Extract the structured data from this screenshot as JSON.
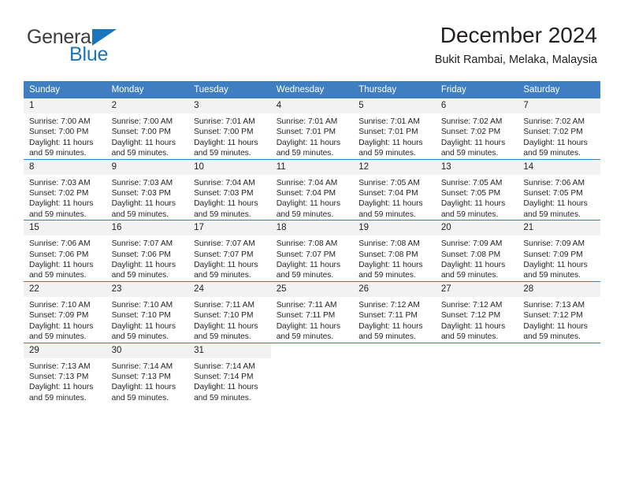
{
  "brand": {
    "name_part1": "General",
    "name_part2": "Blue",
    "logo_icon": "triangle-icon",
    "accent_color": "#1b75bb"
  },
  "header": {
    "title": "December 2024",
    "subtitle": "Bukit Rambai, Melaka, Malaysia"
  },
  "theme": {
    "header_blue": "#3f7fc1",
    "daynum_band": "#f2f2f2",
    "text": "#231f20"
  },
  "weekday_headers": [
    "Sunday",
    "Monday",
    "Tuesday",
    "Wednesday",
    "Thursday",
    "Friday",
    "Saturday"
  ],
  "weeks": [
    [
      {
        "day": "1",
        "sunrise": "Sunrise: 7:00 AM",
        "sunset": "Sunset: 7:00 PM",
        "daylight1": "Daylight: 11 hours",
        "daylight2": "and 59 minutes."
      },
      {
        "day": "2",
        "sunrise": "Sunrise: 7:00 AM",
        "sunset": "Sunset: 7:00 PM",
        "daylight1": "Daylight: 11 hours",
        "daylight2": "and 59 minutes."
      },
      {
        "day": "3",
        "sunrise": "Sunrise: 7:01 AM",
        "sunset": "Sunset: 7:00 PM",
        "daylight1": "Daylight: 11 hours",
        "daylight2": "and 59 minutes."
      },
      {
        "day": "4",
        "sunrise": "Sunrise: 7:01 AM",
        "sunset": "Sunset: 7:01 PM",
        "daylight1": "Daylight: 11 hours",
        "daylight2": "and 59 minutes."
      },
      {
        "day": "5",
        "sunrise": "Sunrise: 7:01 AM",
        "sunset": "Sunset: 7:01 PM",
        "daylight1": "Daylight: 11 hours",
        "daylight2": "and 59 minutes."
      },
      {
        "day": "6",
        "sunrise": "Sunrise: 7:02 AM",
        "sunset": "Sunset: 7:02 PM",
        "daylight1": "Daylight: 11 hours",
        "daylight2": "and 59 minutes."
      },
      {
        "day": "7",
        "sunrise": "Sunrise: 7:02 AM",
        "sunset": "Sunset: 7:02 PM",
        "daylight1": "Daylight: 11 hours",
        "daylight2": "and 59 minutes."
      }
    ],
    [
      {
        "day": "8",
        "sunrise": "Sunrise: 7:03 AM",
        "sunset": "Sunset: 7:02 PM",
        "daylight1": "Daylight: 11 hours",
        "daylight2": "and 59 minutes."
      },
      {
        "day": "9",
        "sunrise": "Sunrise: 7:03 AM",
        "sunset": "Sunset: 7:03 PM",
        "daylight1": "Daylight: 11 hours",
        "daylight2": "and 59 minutes."
      },
      {
        "day": "10",
        "sunrise": "Sunrise: 7:04 AM",
        "sunset": "Sunset: 7:03 PM",
        "daylight1": "Daylight: 11 hours",
        "daylight2": "and 59 minutes."
      },
      {
        "day": "11",
        "sunrise": "Sunrise: 7:04 AM",
        "sunset": "Sunset: 7:04 PM",
        "daylight1": "Daylight: 11 hours",
        "daylight2": "and 59 minutes."
      },
      {
        "day": "12",
        "sunrise": "Sunrise: 7:05 AM",
        "sunset": "Sunset: 7:04 PM",
        "daylight1": "Daylight: 11 hours",
        "daylight2": "and 59 minutes."
      },
      {
        "day": "13",
        "sunrise": "Sunrise: 7:05 AM",
        "sunset": "Sunset: 7:05 PM",
        "daylight1": "Daylight: 11 hours",
        "daylight2": "and 59 minutes."
      },
      {
        "day": "14",
        "sunrise": "Sunrise: 7:06 AM",
        "sunset": "Sunset: 7:05 PM",
        "daylight1": "Daylight: 11 hours",
        "daylight2": "and 59 minutes."
      }
    ],
    [
      {
        "day": "15",
        "sunrise": "Sunrise: 7:06 AM",
        "sunset": "Sunset: 7:06 PM",
        "daylight1": "Daylight: 11 hours",
        "daylight2": "and 59 minutes."
      },
      {
        "day": "16",
        "sunrise": "Sunrise: 7:07 AM",
        "sunset": "Sunset: 7:06 PM",
        "daylight1": "Daylight: 11 hours",
        "daylight2": "and 59 minutes."
      },
      {
        "day": "17",
        "sunrise": "Sunrise: 7:07 AM",
        "sunset": "Sunset: 7:07 PM",
        "daylight1": "Daylight: 11 hours",
        "daylight2": "and 59 minutes."
      },
      {
        "day": "18",
        "sunrise": "Sunrise: 7:08 AM",
        "sunset": "Sunset: 7:07 PM",
        "daylight1": "Daylight: 11 hours",
        "daylight2": "and 59 minutes."
      },
      {
        "day": "19",
        "sunrise": "Sunrise: 7:08 AM",
        "sunset": "Sunset: 7:08 PM",
        "daylight1": "Daylight: 11 hours",
        "daylight2": "and 59 minutes."
      },
      {
        "day": "20",
        "sunrise": "Sunrise: 7:09 AM",
        "sunset": "Sunset: 7:08 PM",
        "daylight1": "Daylight: 11 hours",
        "daylight2": "and 59 minutes."
      },
      {
        "day": "21",
        "sunrise": "Sunrise: 7:09 AM",
        "sunset": "Sunset: 7:09 PM",
        "daylight1": "Daylight: 11 hours",
        "daylight2": "and 59 minutes."
      }
    ],
    [
      {
        "day": "22",
        "sunrise": "Sunrise: 7:10 AM",
        "sunset": "Sunset: 7:09 PM",
        "daylight1": "Daylight: 11 hours",
        "daylight2": "and 59 minutes."
      },
      {
        "day": "23",
        "sunrise": "Sunrise: 7:10 AM",
        "sunset": "Sunset: 7:10 PM",
        "daylight1": "Daylight: 11 hours",
        "daylight2": "and 59 minutes."
      },
      {
        "day": "24",
        "sunrise": "Sunrise: 7:11 AM",
        "sunset": "Sunset: 7:10 PM",
        "daylight1": "Daylight: 11 hours",
        "daylight2": "and 59 minutes."
      },
      {
        "day": "25",
        "sunrise": "Sunrise: 7:11 AM",
        "sunset": "Sunset: 7:11 PM",
        "daylight1": "Daylight: 11 hours",
        "daylight2": "and 59 minutes."
      },
      {
        "day": "26",
        "sunrise": "Sunrise: 7:12 AM",
        "sunset": "Sunset: 7:11 PM",
        "daylight1": "Daylight: 11 hours",
        "daylight2": "and 59 minutes."
      },
      {
        "day": "27",
        "sunrise": "Sunrise: 7:12 AM",
        "sunset": "Sunset: 7:12 PM",
        "daylight1": "Daylight: 11 hours",
        "daylight2": "and 59 minutes."
      },
      {
        "day": "28",
        "sunrise": "Sunrise: 7:13 AM",
        "sunset": "Sunset: 7:12 PM",
        "daylight1": "Daylight: 11 hours",
        "daylight2": "and 59 minutes."
      }
    ],
    [
      {
        "day": "29",
        "sunrise": "Sunrise: 7:13 AM",
        "sunset": "Sunset: 7:13 PM",
        "daylight1": "Daylight: 11 hours",
        "daylight2": "and 59 minutes."
      },
      {
        "day": "30",
        "sunrise": "Sunrise: 7:14 AM",
        "sunset": "Sunset: 7:13 PM",
        "daylight1": "Daylight: 11 hours",
        "daylight2": "and 59 minutes."
      },
      {
        "day": "31",
        "sunrise": "Sunrise: 7:14 AM",
        "sunset": "Sunset: 7:14 PM",
        "daylight1": "Daylight: 11 hours",
        "daylight2": "and 59 minutes."
      },
      {
        "day": "",
        "sunrise": "",
        "sunset": "",
        "daylight1": "",
        "daylight2": ""
      },
      {
        "day": "",
        "sunrise": "",
        "sunset": "",
        "daylight1": "",
        "daylight2": ""
      },
      {
        "day": "",
        "sunrise": "",
        "sunset": "",
        "daylight1": "",
        "daylight2": ""
      },
      {
        "day": "",
        "sunrise": "",
        "sunset": "",
        "daylight1": "",
        "daylight2": ""
      }
    ]
  ]
}
